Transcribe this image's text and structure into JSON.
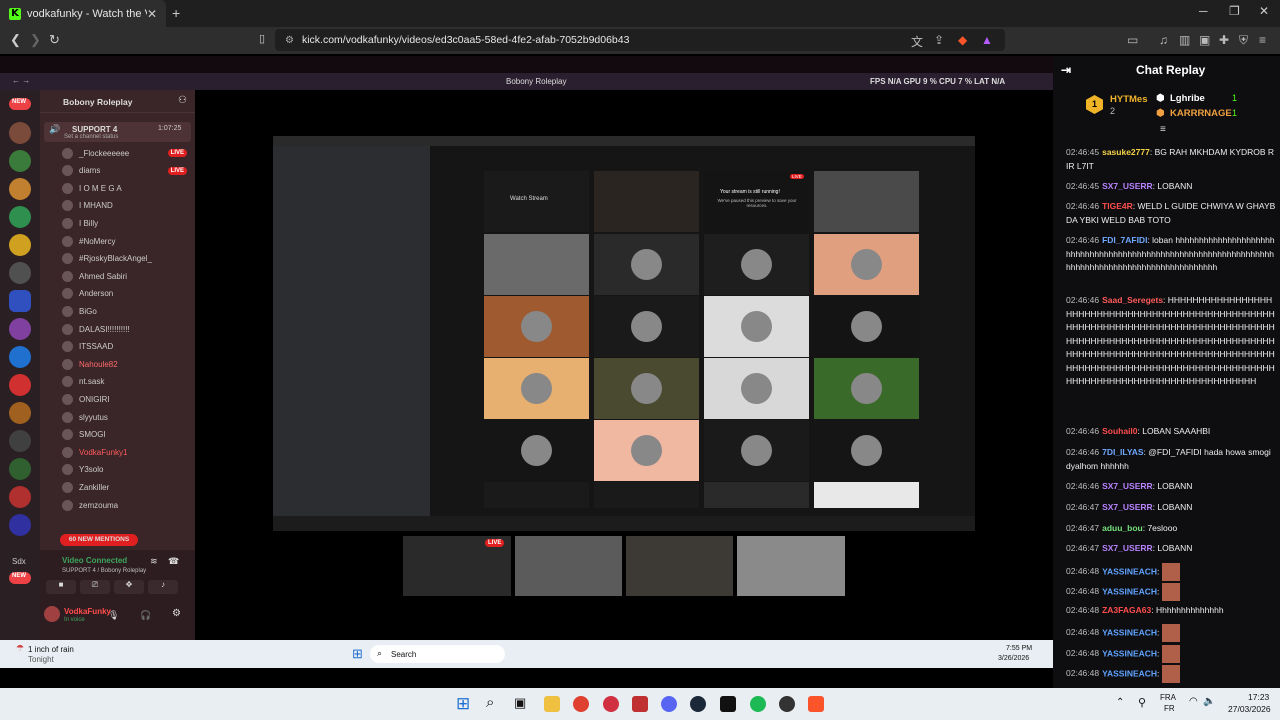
{
  "browser": {
    "tab_title": "vodkafunky - Watch the VOD",
    "tab_favicon": "K",
    "url": "kick.com/vodkafunky/videos/ed3c0aa5-58ed-4fe2-afab-7052b9d06b43"
  },
  "stream": {
    "window_title": "Bobony Roleplay",
    "stats": "FPS N/A   GPU 9 %   CPU 7 %   LAT N/A",
    "discord": {
      "server_name": "Bobony Roleplay",
      "channel": "SUPPORT 4",
      "channel_timer": "1:07:25",
      "channel_status": "Set a channel status",
      "members": [
        "_Flockeeeeee",
        "diams",
        "I O M E G A",
        "I MHAND",
        "I Billy",
        "#NoMercy",
        "#RjoskyBlackAngel_",
        "Ahmed Sabiri",
        "Anderson",
        "BiGo",
        "DALASI!!!!!!!!!!",
        "ITSSAAD",
        "Nahoule82",
        "nt.sask",
        "ONIGIRI",
        "slyyutus",
        "SMOGI",
        "VodkaFunky1",
        "Y3solo",
        "Zankiller",
        "zemzouma"
      ],
      "badges": [
        "LIVE",
        "LIVE"
      ],
      "new_mentions": "60 NEW MENTIONS",
      "voice_status": "Video Connected",
      "voice_sub": "SUPPORT 4 / Bobony Roleplay",
      "user": "VodkaFunky",
      "user_status": "In voice",
      "server_counts": [
        "NEW",
        "2",
        "75",
        "14",
        "96",
        "16",
        "278",
        "49",
        "215",
        "22",
        "207",
        "Sdx",
        "NEW"
      ]
    },
    "inner_tiles": {
      "watch_stream_label": "Watch Stream",
      "paused_title": "Your stream is still running!",
      "paused_text": "We've paused this preview to save your resources.",
      "live_badge": "LIVE"
    },
    "thumb_live": "LIVE",
    "weather_line1": "1 inch of rain",
    "weather_line2": "Tonight",
    "search_placeholder": "Search",
    "clock_time": "7:55 PM",
    "clock_date": "3/26/2026"
  },
  "chat": {
    "title": "Chat Replay",
    "leaderboard": [
      {
        "name": "HYTMes",
        "count": "2"
      },
      {
        "name": "Lghribe",
        "count": "1"
      },
      {
        "name": "KARRRNAGE",
        "count": "1"
      }
    ],
    "leader_rank": "1",
    "messages": [
      {
        "time": "02:46:45",
        "user": "sasuke2777",
        "color": "#f5d547",
        "text": "BG RAH MKHDAM KYDROB RIR L7IT"
      },
      {
        "time": "02:46:45",
        "user": "SX7_USERR",
        "color": "#b883ff",
        "text": "LOBANN"
      },
      {
        "time": "02:46:46",
        "user": "TIGE4R",
        "color": "#ff4d4d",
        "text": "WELD L GUIDE CHWIYA W GHAYBDA YBKI WELD BAB TOTO"
      },
      {
        "time": "02:46:46",
        "user": "FDI_7AFIDI",
        "color": "#6fa8ff",
        "text": "loban hhhhhhhhhhhhhhhhhhhhhhhhhhhhhhhhhhhhhhhhhhhhhhhhhhhhhhhhhhhhhhhhhhhhhhhhhhhhhhhhhhhhhhhhhhhhhhhhh"
      },
      {
        "time": "02:46:46",
        "user": "Saad_Seregets",
        "color": "#ff5b5b",
        "text": "HHHHHHHHHHHHHHHHHHHHHHHHHHHHHHHHHHHHHHHHHHHHHHHHHHHHHHHHHHHHHHHHHHHHHHHHHHHHHHHHHHHHHHHHHHHHHHHHHHHHHHHHHHHHHHHHHHHHHHHHHHHHHHHHHHHHHHHHHHHHHHHHHHHHHHHHHHHHHHHHHHHHHHHHHHHHHHHHHHHHHHHHHHHHHHHHHHHHHHHHHHHHHHHHHHHHHHHHHH"
      },
      {
        "time": "02:46:46",
        "user": "Souhail0",
        "color": "#ff4d4d",
        "text": "LOBAN SAAAHBI"
      },
      {
        "time": "02:46:46",
        "user": "7DI_ILYAS",
        "color": "#6fa8ff",
        "text": "@FDI_7AFIDI hada howa smogi dyalhom hhhhhh"
      },
      {
        "time": "02:46:46",
        "user": "SX7_USERR",
        "color": "#b883ff",
        "text": "LOBANN"
      },
      {
        "time": "02:46:47",
        "user": "SX7_USERR",
        "color": "#b883ff",
        "text": "LOBANN"
      },
      {
        "time": "02:46:47",
        "user": "aduu_bou",
        "color": "#75e07a",
        "text": "7eslooo"
      },
      {
        "time": "02:46:47",
        "user": "SX7_USERR",
        "color": "#b883ff",
        "text": "LOBANN"
      },
      {
        "time": "02:46:48",
        "user": "YASSINEACH",
        "color": "#5fa3ff",
        "text": ""
      },
      {
        "time": "02:46:48",
        "user": "YASSINEACH",
        "color": "#5fa3ff",
        "text": ""
      },
      {
        "time": "02:46:48",
        "user": "ZA3FAGA63",
        "color": "#ff4d4d",
        "text": "Hhhhhhhhhhhhhh"
      },
      {
        "time": "02:46:48",
        "user": "YASSINEACH",
        "color": "#5fa3ff",
        "text": ""
      },
      {
        "time": "02:46:48",
        "user": "YASSINEACH",
        "color": "#5fa3ff",
        "text": ""
      },
      {
        "time": "02:46:48",
        "user": "YASSINEACH",
        "color": "#5fa3ff",
        "text": ""
      }
    ]
  },
  "taskbar": {
    "lang": "FRA",
    "lang2": "FR",
    "time": "17:23",
    "date": "27/03/2026"
  },
  "colors": {
    "kick_green": "#53fc18",
    "chat_bg": "#0e0e10"
  }
}
